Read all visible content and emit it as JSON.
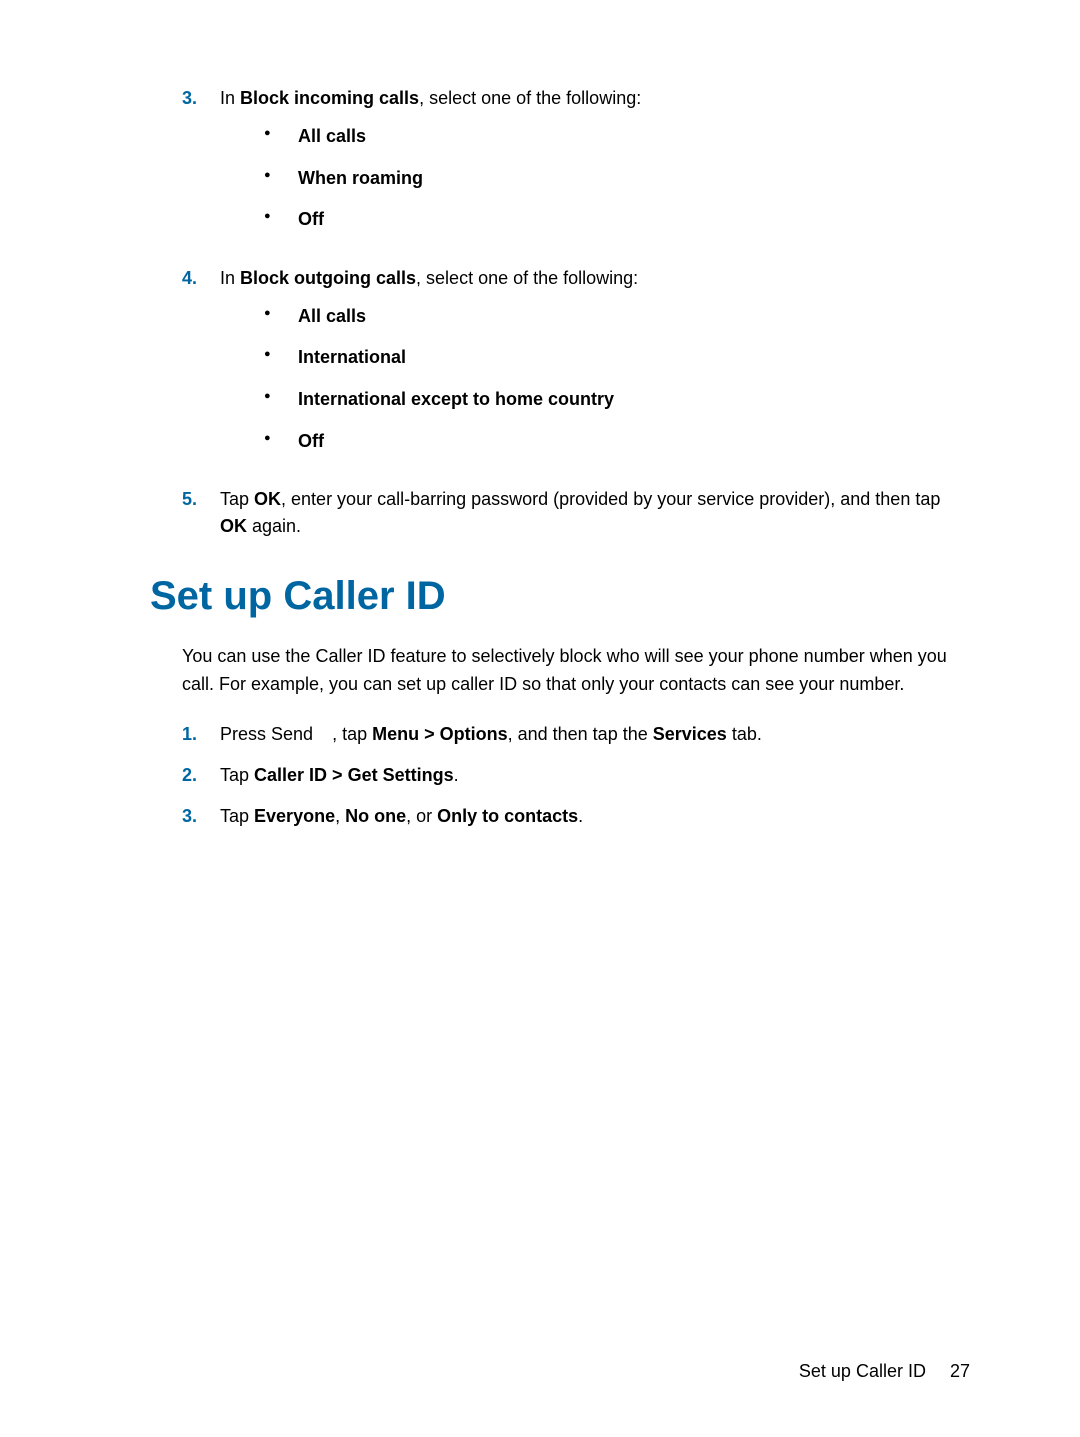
{
  "steps_top": {
    "s3": {
      "num": "3.",
      "prefix": "In ",
      "bold": "Block incoming calls",
      "suffix": ", select one of the following:",
      "items": [
        "All calls",
        "When roaming",
        "Off"
      ]
    },
    "s4": {
      "num": "4.",
      "prefix": "In ",
      "bold": "Block outgoing calls",
      "suffix": ", select one of the following:",
      "items": [
        "All calls",
        "International",
        "International except to home country",
        "Off"
      ]
    },
    "s5": {
      "num": "5.",
      "t1": "Tap ",
      "b1": "OK",
      "t2": ", enter your call-barring password (provided by your service provider), and then tap ",
      "b2": "OK",
      "t3": " again."
    }
  },
  "section_heading": "Set up Caller ID",
  "section_paragraph": "You can use the Caller ID feature to selectively block who will see your phone number when you call. For example, you can set up caller ID so that only your contacts can see your number.",
  "steps_bottom": {
    "s1": {
      "num": "1.",
      "t1": "Press Send ",
      "t2": ", tap ",
      "b1": "Menu > Options",
      "t3": ", and then tap the ",
      "b2": "Services",
      "t4": " tab."
    },
    "s2": {
      "num": "2.",
      "t1": "Tap ",
      "b1": "Caller ID > Get Settings",
      "t2": "."
    },
    "s3": {
      "num": "3.",
      "t1": "Tap ",
      "b1": "Everyone",
      "t2": ", ",
      "b2": "No one",
      "t3": ", or ",
      "b3": "Only to contacts",
      "t4": "."
    }
  },
  "footer": {
    "label": "Set up Caller ID",
    "page": "27"
  }
}
